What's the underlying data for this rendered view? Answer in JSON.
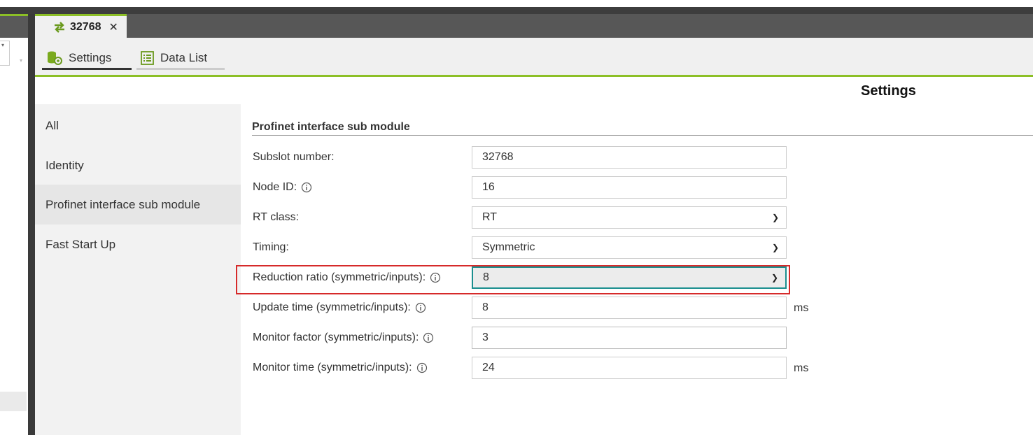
{
  "tab": {
    "title": "32768",
    "swap_icon": "swap-arrows-icon",
    "close_icon": "close-icon",
    "accent": "#8cbf26"
  },
  "subtabs": [
    {
      "label": "Settings",
      "icon": "settings-db-icon",
      "active": true
    },
    {
      "label": "Data List",
      "icon": "list-icon",
      "active": false
    }
  ],
  "heading": "Settings",
  "nav": [
    {
      "label": "All"
    },
    {
      "label": "Identity"
    },
    {
      "label": "Profinet interface sub module"
    },
    {
      "label": "Fast Start Up"
    }
  ],
  "section": {
    "title": "Profinet interface sub module",
    "rows": [
      {
        "label": "Subslot number:",
        "value": "32768",
        "info": false,
        "unit": ""
      },
      {
        "label": "Node ID:",
        "value": "16",
        "info": true,
        "unit": ""
      },
      {
        "label": "RT class:",
        "value": "RT",
        "info": false,
        "unit": "",
        "select": true
      },
      {
        "label": "Timing:",
        "value": "Symmetric",
        "info": false,
        "unit": "",
        "select": true
      },
      {
        "label": "Reduction ratio (symmetric/inputs):",
        "value": "8",
        "info": true,
        "unit": "",
        "select": true,
        "highlighted": true
      },
      {
        "label": "Update time (symmetric/inputs):",
        "value": "8",
        "info": true,
        "unit": "ms"
      },
      {
        "label": "Monitor factor (symmetric/inputs):",
        "value": "3",
        "info": true,
        "unit": ""
      },
      {
        "label": "Monitor time (symmetric/inputs):",
        "value": "24",
        "info": true,
        "unit": "ms"
      }
    ]
  },
  "colors": {
    "accent": "#8cbf26",
    "focus": "#1b8f8f",
    "highlight": "#d62a2a"
  }
}
